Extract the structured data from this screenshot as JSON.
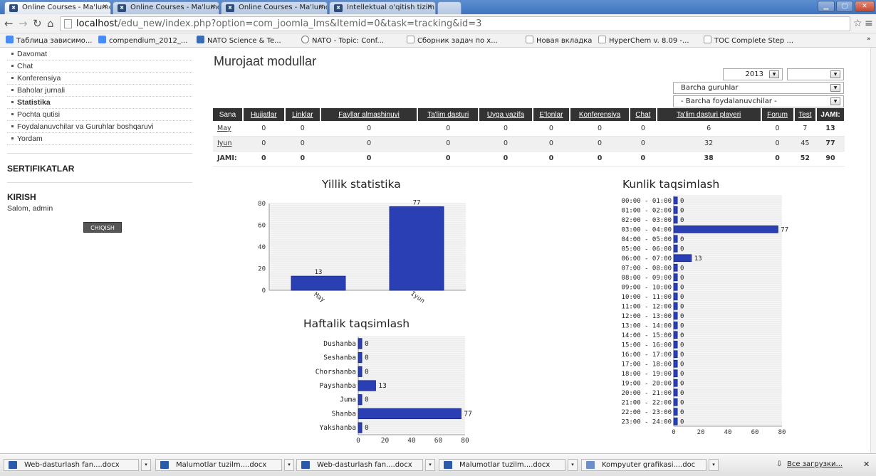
{
  "browser": {
    "tabs": [
      {
        "label": "Online Courses - Ma'lumo"
      },
      {
        "label": "Online Courses - Ma'lumo"
      },
      {
        "label": "Online Courses - Ma'lumo"
      },
      {
        "label": "Intellektual o'qitish tizimi"
      }
    ],
    "url_host": "localhost",
    "url_path": "/edu_new/index.php?option=com_joomla_lms&Itemid=0&task=tracking&id=3",
    "bookmarks": [
      {
        "label": "Таблица зависимо..."
      },
      {
        "label": "compendium_2012_..."
      },
      {
        "label": "NATO Science & Te..."
      },
      {
        "label": "NATO - Topic: Conf..."
      },
      {
        "label": "Сборник задач по х..."
      },
      {
        "label": "Новая вкладка"
      },
      {
        "label": "HyperChem v. 8.09 -..."
      },
      {
        "label": "TOC Complete Step ..."
      }
    ]
  },
  "sidebar": {
    "items": [
      {
        "label": "Davomat"
      },
      {
        "label": "Chat"
      },
      {
        "label": "Konferensiya"
      },
      {
        "label": "Baholar jurnali"
      },
      {
        "label": "Statistika"
      },
      {
        "label": "Pochta qutisi"
      },
      {
        "label": "Foydalanuvchilar va Guruhlar boshqaruvi"
      },
      {
        "label": "Yordam"
      }
    ],
    "cert_heading": "SERTIFIKATLAR",
    "login_heading": "KIRISH",
    "greeting": "Salom, admin",
    "logout_label": "CHIQISH"
  },
  "main": {
    "title": "Murojaat modullar",
    "year": "2013",
    "group_filter": "Barcha guruhlar",
    "user_filter": "- Barcha foydalanuvchilar -"
  },
  "table": {
    "headers": [
      "Sana",
      "Hujjatlar",
      "Linklar",
      "Fayllar almashinuvi",
      "Ta'lim dasturi",
      "Uyga vazifa",
      "E'lonlar",
      "Konferensiya",
      "Chat",
      "Ta'lim dasturi playeri",
      "Forum",
      "Test",
      "JAMI:"
    ],
    "rows": [
      [
        "May",
        "0",
        "0",
        "0",
        "0",
        "0",
        "0",
        "0",
        "0",
        "6",
        "0",
        "7",
        "13"
      ],
      [
        "Iyun",
        "0",
        "0",
        "0",
        "0",
        "0",
        "0",
        "0",
        "0",
        "32",
        "0",
        "45",
        "77"
      ],
      [
        "JAMI:",
        "0",
        "0",
        "0",
        "0",
        "0",
        "0",
        "0",
        "0",
        "38",
        "0",
        "52",
        "90"
      ]
    ]
  },
  "chart_data": [
    {
      "type": "bar",
      "title": "Yillik statistika",
      "categories": [
        "May",
        "Iyun"
      ],
      "values": [
        13,
        77
      ],
      "ylim": [
        0,
        80
      ],
      "yticks": [
        0,
        20,
        40,
        60,
        80
      ]
    },
    {
      "type": "bar",
      "orientation": "horizontal",
      "title": "Haftalik taqsimlash",
      "categories": [
        "Dushanba",
        "Seshanba",
        "Chorshanba",
        "Payshanba",
        "Juma",
        "Shanba",
        "Yakshanba"
      ],
      "values": [
        0,
        0,
        0,
        13,
        0,
        77,
        0
      ],
      "xlim": [
        0,
        80
      ],
      "xticks": [
        0,
        20,
        40,
        60,
        80
      ]
    },
    {
      "type": "bar",
      "orientation": "horizontal",
      "title": "Kunlik taqsimlash",
      "categories": [
        "00:00 - 01:00",
        "01:00 - 02:00",
        "02:00 - 03:00",
        "03:00 - 04:00",
        "04:00 - 05:00",
        "05:00 - 06:00",
        "06:00 - 07:00",
        "07:00 - 08:00",
        "08:00 - 09:00",
        "09:00 - 10:00",
        "10:00 - 11:00",
        "11:00 - 12:00",
        "12:00 - 13:00",
        "13:00 - 14:00",
        "14:00 - 15:00",
        "15:00 - 16:00",
        "16:00 - 17:00",
        "17:00 - 18:00",
        "18:00 - 19:00",
        "19:00 - 20:00",
        "20:00 - 21:00",
        "21:00 - 22:00",
        "22:00 - 23:00",
        "23:00 - 24:00"
      ],
      "values": [
        0,
        0,
        0,
        77,
        0,
        0,
        13,
        0,
        0,
        0,
        0,
        0,
        0,
        0,
        0,
        0,
        0,
        0,
        0,
        0,
        0,
        0,
        0,
        0
      ],
      "xlim": [
        0,
        80
      ],
      "xticks": [
        0,
        20,
        40,
        60,
        80
      ]
    }
  ],
  "taskbar": {
    "items": [
      {
        "label": "Web-dasturlash fan....docx"
      },
      {
        "label": "Malumotlar tuzilm....docx"
      },
      {
        "label": "Web-dasturlash fan....docx"
      },
      {
        "label": "Malumotlar tuzilm....docx"
      },
      {
        "label": "Kompyuter grafikasi....doc"
      }
    ],
    "downloads_label": "Все загрузки..."
  },
  "colors": {
    "bar": "#2b3fb5",
    "header_bg": "#333333"
  }
}
